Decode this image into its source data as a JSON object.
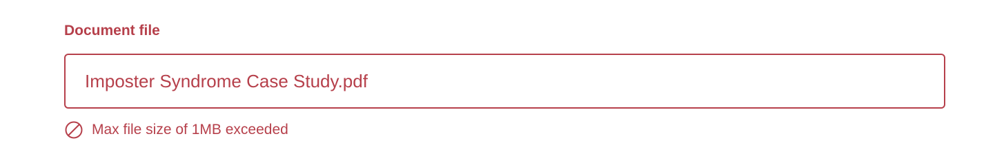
{
  "field": {
    "label": "Document file",
    "value": "Imposter Syndrome Case Study.pdf",
    "error_message": "Max file size of 1MB exceeded",
    "error_icon": "prohibited-icon"
  },
  "colors": {
    "error": "#b6404b",
    "background": "#ffffff"
  }
}
